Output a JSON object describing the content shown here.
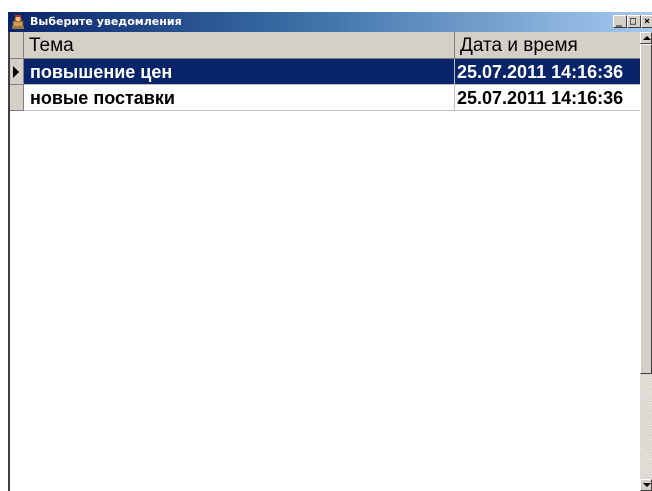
{
  "window": {
    "title": "Выберите уведомления",
    "icon": "app-icon",
    "controls": {
      "minimize_icon": "minimize-icon",
      "maximize_icon": "maximize-icon",
      "close_icon": "close-icon"
    }
  },
  "grid": {
    "columns": [
      "Тема",
      "Дата и время"
    ],
    "rows": [
      {
        "topic": "повышение цен",
        "datetime": "25.07.2011 14:16:36",
        "selected": true
      },
      {
        "topic": "новые поставки",
        "datetime": "25.07.2011 14:16:36",
        "selected": false
      }
    ]
  },
  "colors": {
    "selection": "#0a246a",
    "titlebar_start": "#0a246a",
    "titlebar_end": "#a6caf0",
    "chrome": "#d4d0c8"
  }
}
